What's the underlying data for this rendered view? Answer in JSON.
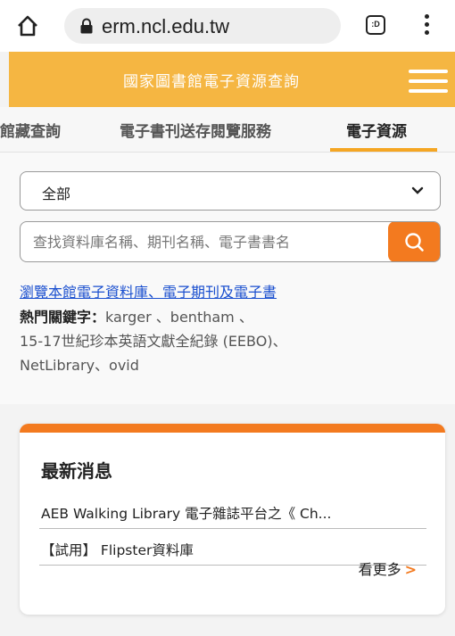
{
  "browser": {
    "url": "erm.ncl.edu.tw",
    "tabs_icon_label": ":D"
  },
  "header": {
    "title": "國家圖書館電子資源查詢"
  },
  "nav": {
    "tabs": [
      {
        "label": "館藏查詢"
      },
      {
        "label": "電子書刊送存閱覽服務"
      },
      {
        "label": "電子資源"
      }
    ]
  },
  "search": {
    "select_value": "全部",
    "placeholder": "查找資料庫名稱、期刊名稱、電子書書名",
    "browse_link": "瀏覽本館電子資料庫、電子期刊及電子書",
    "hot_label": "熱門關鍵字：",
    "keywords": [
      "karger",
      "bentham",
      "15-17世紀珍本英語文獻全紀錄 (EEBO)",
      "NetLibrary",
      "ovid"
    ],
    "separator": "、"
  },
  "news": {
    "title": "最新消息",
    "items": [
      {
        "text": "AEB Walking Library 電子雜誌平台之《 Ch..."
      },
      {
        "text": "【試用】 Flipster資料庫"
      }
    ],
    "more_label": "看更多",
    "more_arrow": ">"
  },
  "colors": {
    "header": "#f5b642",
    "accent": "#f37a1f",
    "link": "#1a4fcf"
  },
  "icons": [
    "home-icon",
    "lock-icon",
    "tabs-icon",
    "kebab-menu-icon",
    "hamburger-menu-icon",
    "chevron-down-icon",
    "search-icon"
  ]
}
